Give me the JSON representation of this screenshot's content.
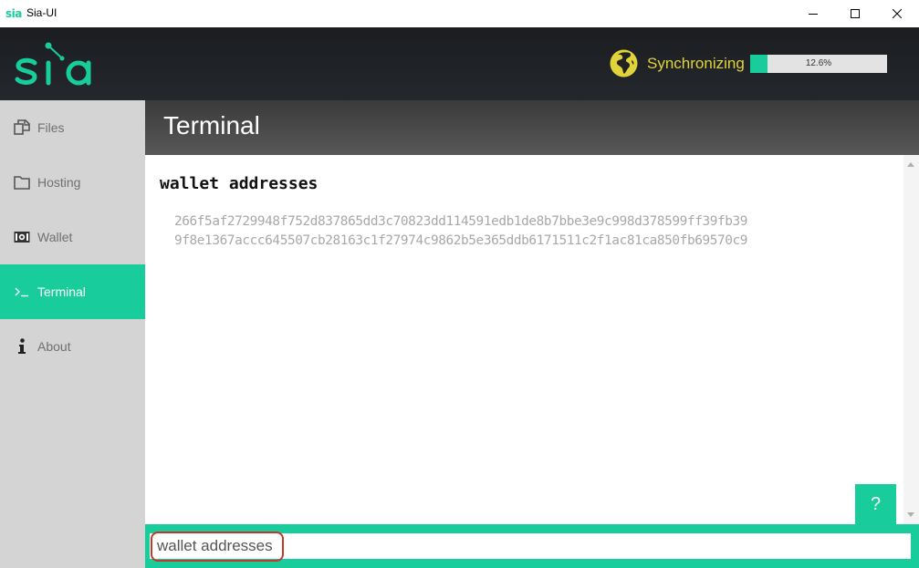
{
  "window": {
    "logo_text": "sia",
    "title": "Sia-UI",
    "controls": [
      "minimize-icon",
      "maximize-icon",
      "close-icon"
    ]
  },
  "header": {
    "logo_icon": "sia-logo-icon",
    "sync_icon": "globe-icon",
    "sync_label": "Synchronizing",
    "progress": {
      "value": 0.126,
      "label": "12.6%"
    }
  },
  "sidebar": {
    "items": [
      {
        "label": "Files",
        "icon": "files-icon",
        "active": false
      },
      {
        "label": "Hosting",
        "icon": "folder-icon",
        "active": false
      },
      {
        "label": "Wallet",
        "icon": "wallet-icon",
        "active": false
      },
      {
        "label": "Terminal",
        "icon": "terminal-icon",
        "active": true
      },
      {
        "label": "About",
        "icon": "info-icon",
        "active": false
      }
    ]
  },
  "terminal": {
    "title": "Terminal",
    "command": "wallet addresses",
    "output": [
      "266f5af2729948f752d837865dd3c70823dd114591edb1de8b7bbe3e9c998d378599ff39fb39",
      "9f8e1367accc645507cb28163c1f27974c9862b5e365ddb6171511c2f1ac81ca850fb69570c9"
    ],
    "help_label": "?",
    "input_value": "wallet addresses"
  },
  "colors": {
    "accent": "#19cc9c",
    "sync_text": "#e1d33a",
    "header_bg": "#1b1d21",
    "sidebar_bg": "#d4d4d4",
    "highlight": "#c0392b"
  }
}
